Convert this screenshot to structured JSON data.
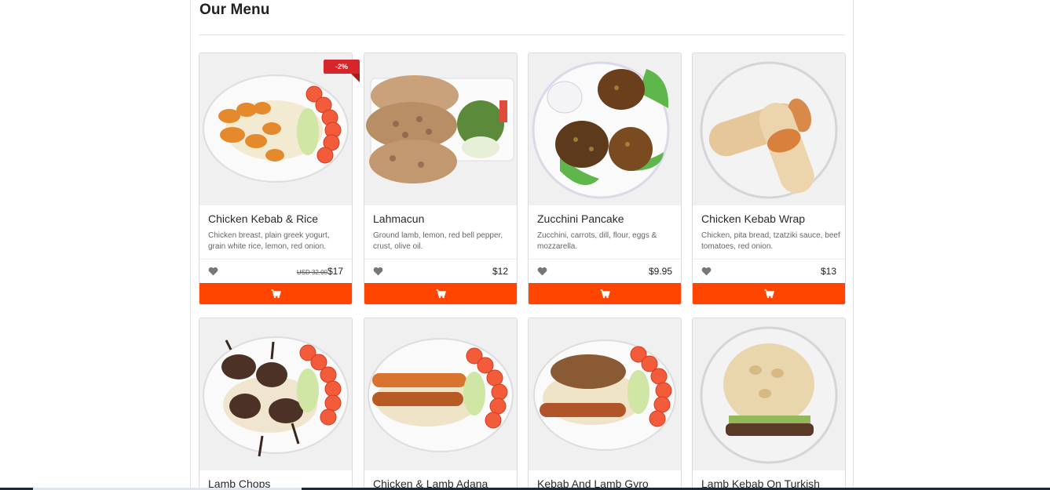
{
  "section": {
    "title": "Our Menu"
  },
  "cart_icon": "shopping-cart-icon",
  "heart_icon": "heart-icon",
  "accent_color": "#ff4500",
  "badge_color": "#d6262b",
  "items": [
    {
      "name": "Chicken Kebab & Rice",
      "description": "Chicken breast, plain greek yogurt, grain white rice, lemon, red onion.",
      "old_price": "USD 32.00",
      "price": "$17",
      "badge": "-2%"
    },
    {
      "name": "Lahmacun",
      "description": "Ground lamb, lemon, red bell pepper, crust, olive oil.",
      "price": "$12"
    },
    {
      "name": "Zucchini Pancake",
      "description": "Zucchini, carrots, dill, flour, eggs & mozzarella.",
      "price": "$9.95"
    },
    {
      "name": "Chicken Kebab Wrap",
      "description": "Chicken, pita bread, tzatziki sauce, beef tomatoes, red onion.",
      "price": "$13"
    },
    {
      "name": "Lamb Chops"
    },
    {
      "name": "Chicken & Lamb Adana"
    },
    {
      "name": "Kebab And Lamb Gyro"
    },
    {
      "name": "Lamb Kebab On Turkish"
    }
  ]
}
